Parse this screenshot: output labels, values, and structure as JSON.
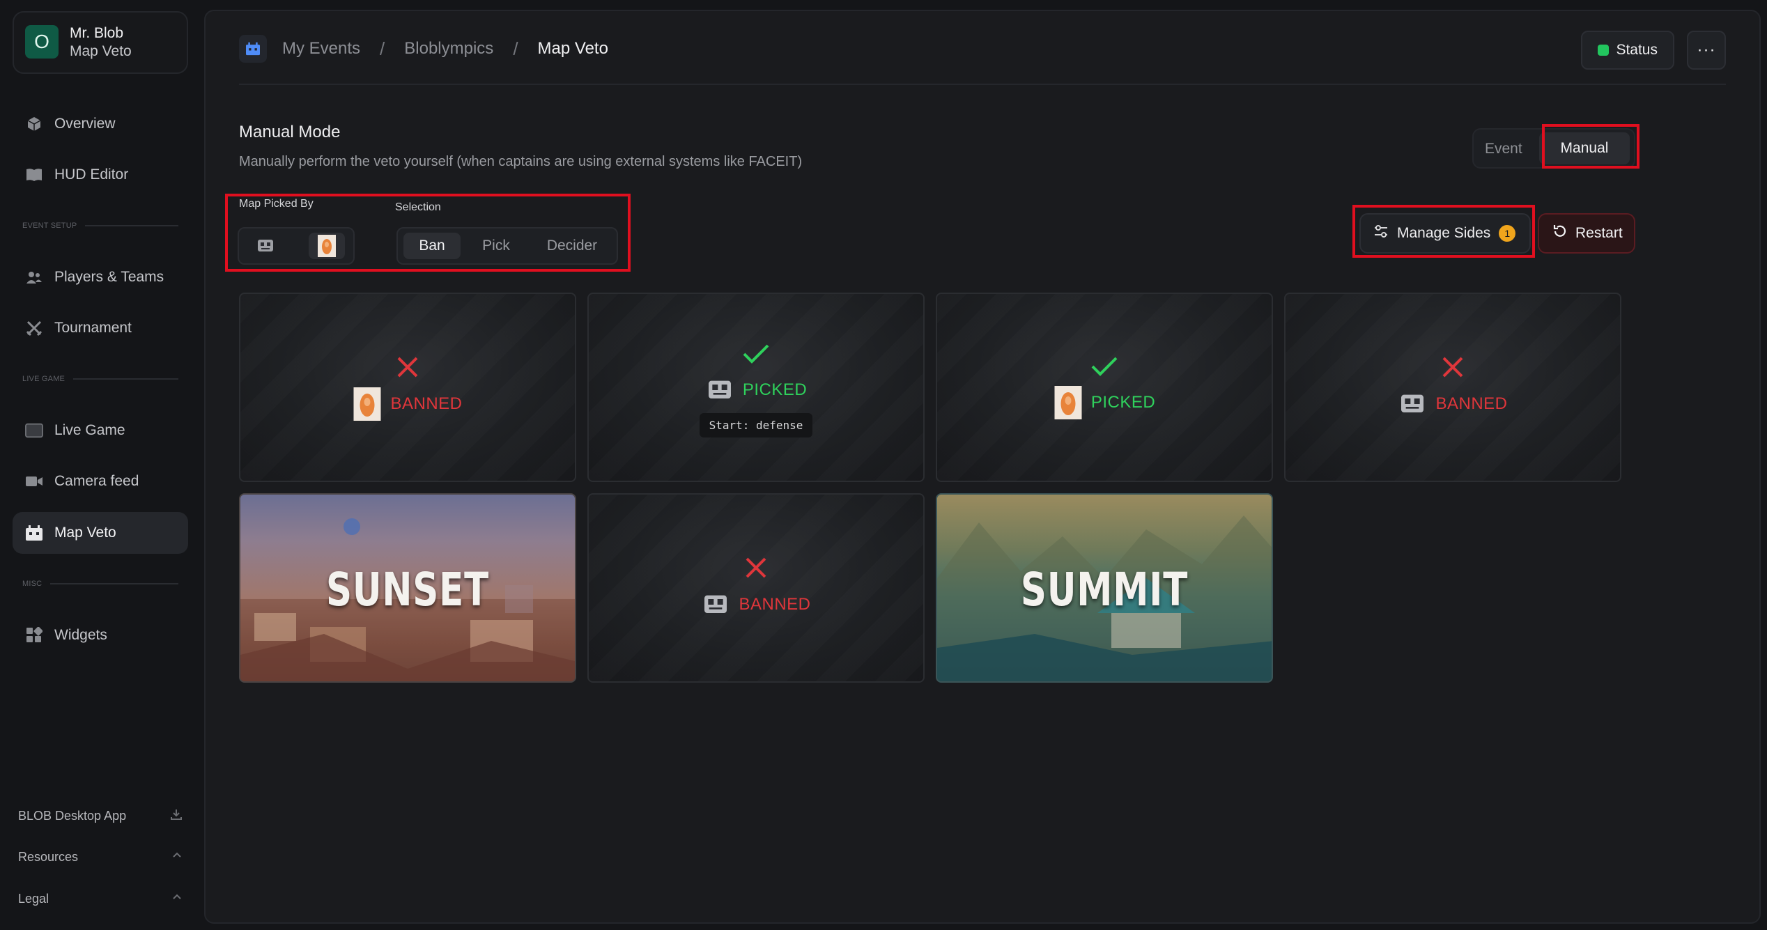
{
  "user": {
    "initial": "O",
    "name": "Mr. Blob",
    "subtitle": "Map Veto"
  },
  "sidebar": {
    "items": [
      {
        "label": "Overview",
        "icon": "cube-icon"
      },
      {
        "label": "HUD Editor",
        "icon": "book-icon"
      },
      {
        "label": "Players & Teams",
        "icon": "users-icon"
      },
      {
        "label": "Tournament",
        "icon": "swords-icon"
      },
      {
        "label": "Live Game",
        "icon": "screen-icon"
      },
      {
        "label": "Camera feed",
        "icon": "camera-icon"
      },
      {
        "label": "Map Veto",
        "icon": "veto-icon",
        "active": true
      },
      {
        "label": "Widgets",
        "icon": "widgets-icon"
      }
    ],
    "sections": {
      "event_setup": "EVENT SETUP",
      "live_game": "LIVE GAME",
      "misc": "MISC"
    },
    "footer": {
      "desktop_app": "BLOB Desktop App",
      "resources": "Resources",
      "legal": "Legal"
    }
  },
  "breadcrumb": {
    "items": [
      "My Events",
      "Bloblympics",
      "Map Veto"
    ],
    "separator": "/"
  },
  "header": {
    "status_label": "Status",
    "status_color": "#22c55e",
    "more": "···"
  },
  "mode": {
    "title": "Manual Mode",
    "description": "Manually perform the veto yourself (when captains are using external systems like FACEIT)",
    "toggle": {
      "event": "Event",
      "manual": "Manual",
      "selected": "manual"
    }
  },
  "controls": {
    "picked_by_label": "Map Picked By",
    "selection_label": "Selection",
    "selection_options": [
      "Ban",
      "Pick",
      "Decider"
    ],
    "selected_option": "Ban",
    "manage_sides_label": "Manage Sides",
    "manage_sides_badge": "1",
    "restart_label": "Restart"
  },
  "maps": [
    {
      "state": "banned",
      "status_text": "BANNED",
      "team": "orange"
    },
    {
      "state": "picked",
      "status_text": "PICKED",
      "team": "robot",
      "start": "Start: defense"
    },
    {
      "state": "picked",
      "status_text": "PICKED",
      "team": "orange"
    },
    {
      "state": "banned",
      "status_text": "BANNED",
      "team": "robot"
    },
    {
      "state": "open",
      "name": "SUNSET"
    },
    {
      "state": "banned",
      "status_text": "BANNED",
      "team": "robot"
    },
    {
      "state": "open",
      "name": "SUMMIT"
    }
  ],
  "colors": {
    "banned": "#e0363b",
    "picked": "#2fd15c",
    "highlight": "#e00f1f",
    "badge": "#f0a51c"
  }
}
